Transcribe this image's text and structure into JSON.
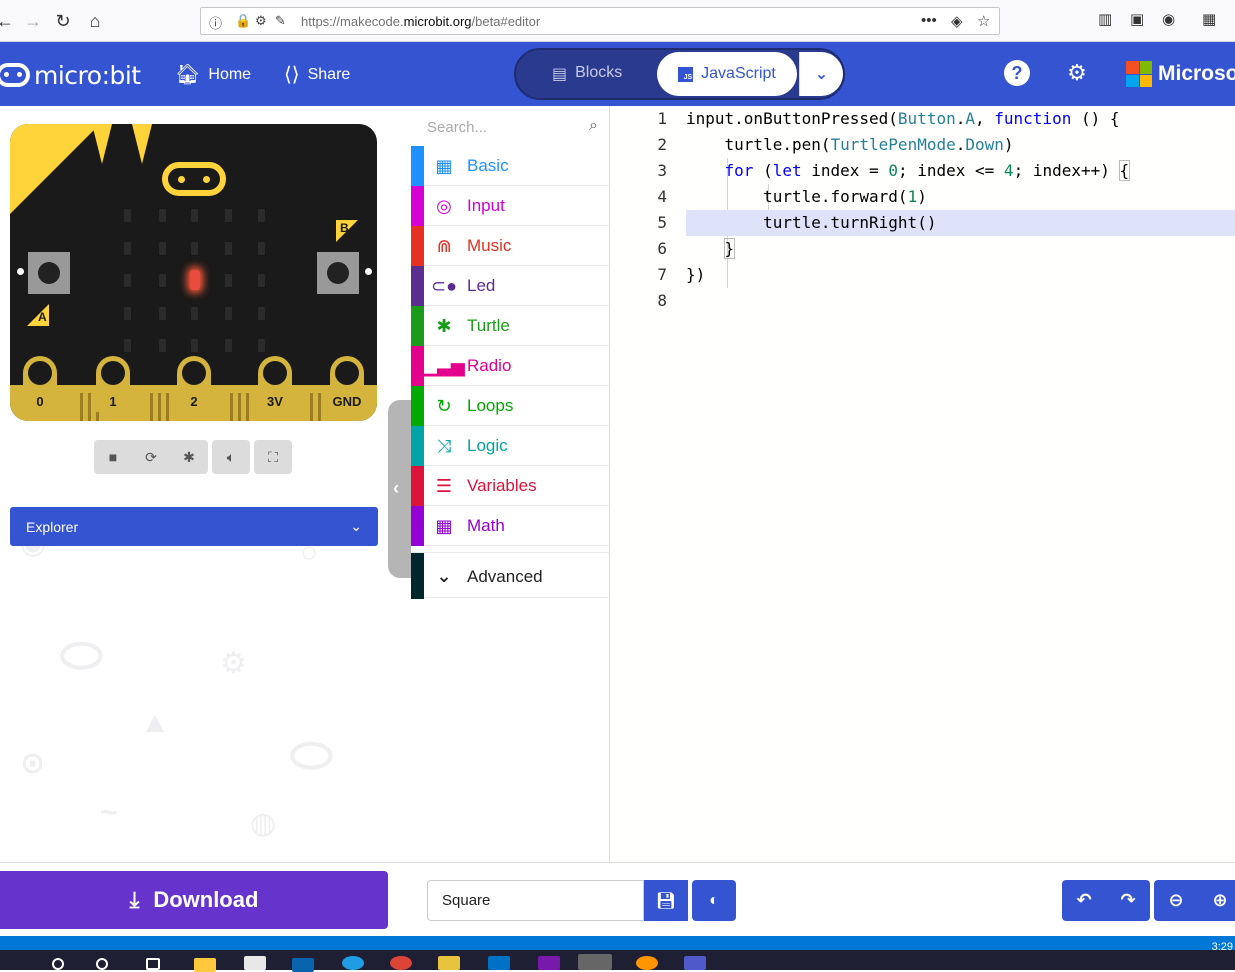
{
  "browser": {
    "url_prefix": "https://makecode.",
    "url_domain": "microbit.org",
    "url_path": "/beta#editor",
    "more_glyph": "•••"
  },
  "header": {
    "brand": "micro:bit",
    "home_label": "Home",
    "share_label": "Share",
    "blocks_label": "Blocks",
    "javascript_label": "JavaScript",
    "js_badge": "JS",
    "help_glyph": "?",
    "microsoft_label": "Microsoft",
    "microsoft_colors": [
      "#f25022",
      "#7fba00",
      "#00a4ef",
      "#ffb900"
    ]
  },
  "simulator": {
    "button_a_label": "A",
    "button_b_label": "B",
    "pins": [
      "0",
      "1",
      "2",
      "3V",
      "GND"
    ],
    "lit_led": {
      "row": 2,
      "col": 2
    },
    "explorer_label": "Explorer"
  },
  "toolbox": {
    "search_placeholder": "Search...",
    "categories": [
      {
        "label": "Basic",
        "color": "#1e90ff",
        "icon": "grid-icon"
      },
      {
        "label": "Input",
        "color": "#d400d4",
        "icon": "target-icon"
      },
      {
        "label": "Music",
        "color": "#e63022",
        "icon": "headphones-icon"
      },
      {
        "label": "Led",
        "color": "#5c2d91",
        "icon": "toggle-icon"
      },
      {
        "label": "Turtle",
        "color": "#1a9c1a",
        "icon": "bug-icon"
      },
      {
        "label": "Radio",
        "color": "#e3008c",
        "icon": "signal-icon"
      },
      {
        "label": "Loops",
        "color": "#00aa00",
        "icon": "refresh-icon"
      },
      {
        "label": "Logic",
        "color": "#00a4a6",
        "icon": "shuffle-icon"
      },
      {
        "label": "Variables",
        "color": "#dc143c",
        "icon": "list-icon"
      },
      {
        "label": "Math",
        "color": "#9400d3",
        "icon": "calculator-icon"
      }
    ],
    "advanced_label": "Advanced",
    "advanced_color": "#00272b"
  },
  "editor": {
    "line_numbers": [
      "1",
      "2",
      "3",
      "4",
      "5",
      "6",
      "7",
      "8"
    ],
    "highlighted_line": 5
  },
  "bottom": {
    "download_label": "Download",
    "project_name": "Square"
  },
  "taskbar": {
    "clock": "3:29"
  }
}
